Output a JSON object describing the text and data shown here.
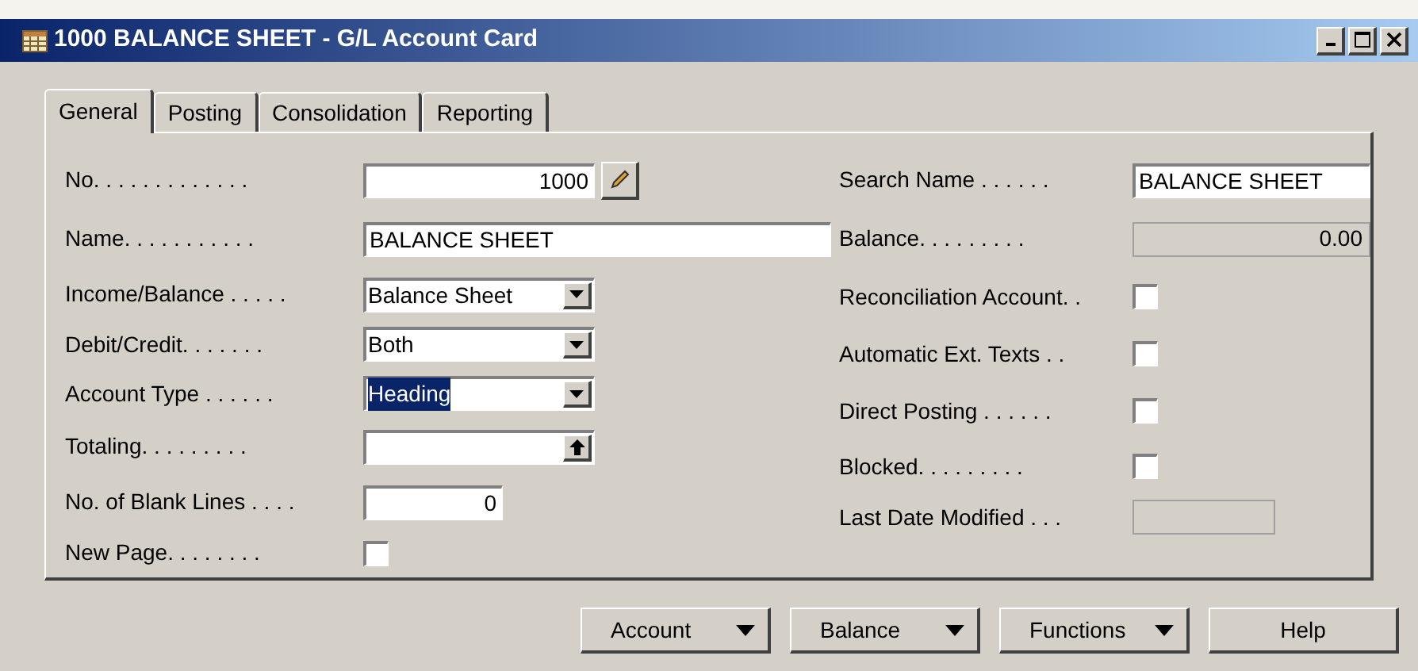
{
  "window": {
    "title": "1000 BALANCE SHEET - G/L Account Card"
  },
  "tabs": [
    {
      "label": "General",
      "selected": true
    },
    {
      "label": "Posting",
      "selected": false
    },
    {
      "label": "Consolidation",
      "selected": false
    },
    {
      "label": "Reporting",
      "selected": false
    }
  ],
  "left_fields": [
    {
      "label": "No. . . . . . . . . . . . .",
      "kind": "number",
      "value": "1000",
      "edit_button": true
    },
    {
      "label": "Name. . . . . . . . . . .",
      "kind": "wide",
      "value": "BALANCE SHEET"
    },
    {
      "label": "Income/Balance . . . . .",
      "kind": "dropdown",
      "value": "Balance Sheet",
      "highlighted": false
    },
    {
      "label": "Debit/Credit. . . . . . .",
      "kind": "dropdown",
      "value": "Both",
      "highlighted": false
    },
    {
      "label": "Account Type . . . . . .",
      "kind": "dropdown",
      "value": "Heading",
      "highlighted": true
    },
    {
      "label": "Totaling. . . . . . . . .",
      "kind": "lookup"
    },
    {
      "label": "No. of Blank Lines . . . .",
      "kind": "number",
      "value": "0",
      "edit_button": false
    },
    {
      "label": "New Page. . . . . . . .",
      "kind": "checkbox",
      "checked": false
    }
  ],
  "right_fields": [
    {
      "label": "Search Name . . . . . .",
      "kind": "text",
      "value": "BALANCE SHEET"
    },
    {
      "label": "Balance. . . . . . . . .",
      "kind": "readonly",
      "value": "0.00"
    },
    {
      "label": "Reconciliation Account. .",
      "kind": "checkbox",
      "checked": false
    },
    {
      "label": "Automatic Ext. Texts . .",
      "kind": "checkbox",
      "checked": false
    },
    {
      "label": "Direct Posting . . . . . .",
      "kind": "checkbox",
      "checked": false
    },
    {
      "label": "Blocked. . . . . . . . .",
      "kind": "checkbox",
      "checked": false
    },
    {
      "label": "Last Date Modified . . .",
      "kind": "readonly"
    }
  ],
  "buttons": [
    {
      "label": "Account",
      "dropdown": true
    },
    {
      "label": "Balance",
      "dropdown": true
    },
    {
      "label": "Functions",
      "dropdown": true
    },
    {
      "label": "Help",
      "dropdown": false
    }
  ]
}
